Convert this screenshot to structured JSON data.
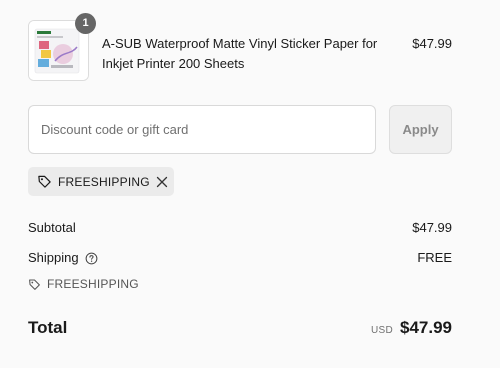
{
  "product": {
    "image_alt": "sticker paper package",
    "quantity": "1",
    "title": "A-SUB Waterproof Matte Vinyl Sticker Paper for Inkjet Printer 200 Sheets",
    "price": "$47.99"
  },
  "discount": {
    "placeholder": "Discount code or gift card",
    "value": "",
    "apply_label": "Apply"
  },
  "applied_code": {
    "code": "FREESHIPPING",
    "tag_icon": "tag-icon",
    "remove_icon": "close-icon"
  },
  "totals": {
    "subtotal_label": "Subtotal",
    "subtotal_value": "$47.99",
    "shipping_label": "Shipping",
    "shipping_help_icon": "question-circle-icon",
    "shipping_value": "FREE",
    "discount_code": "FREESHIPPING",
    "total_label": "Total",
    "currency": "USD",
    "total_value": "$47.99"
  },
  "colors": {
    "badge": "#666666",
    "tag_background": "#ebebeb",
    "apply_background": "#f0f0f0"
  }
}
